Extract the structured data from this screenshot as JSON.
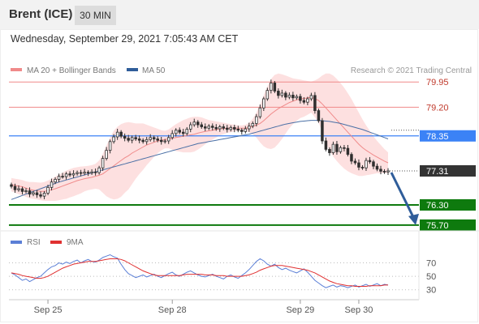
{
  "header": {
    "instrument": "Brent (ICE)",
    "timeframe": "30 MIN"
  },
  "timestamp": "Wednesday, September 29, 2021 7:05:43 AM CET",
  "colors": {
    "candle_up": "#2f2f2f",
    "candle_down": "#2f2f2f",
    "ma20": "#f08a8a",
    "bollinger_fill": "#fcd6d6",
    "ma50": "#4a6fa5",
    "resistance": "#f08a8a",
    "pivot": "#3b82f6",
    "support": "#0e7a0e",
    "last_price": "#333333",
    "rsi": "#5b7fd6",
    "rsi_ma": "#e03030",
    "arrow": "#2f5d9a"
  },
  "chart_data": [
    {
      "type": "candlestick",
      "panel": "price",
      "legend": [
        {
          "name": "MA 20 + Bollinger Bands",
          "color": "#f08a8a"
        },
        {
          "name": "MA 50",
          "color": "#2f5d9a"
        }
      ],
      "copyright": "Research © 2021 Trading Central",
      "x_ticks": [
        "Sep 25",
        "Sep 28",
        "Sep 29",
        "Sep 30"
      ],
      "y_range": [
        75.65,
        80.1
      ],
      "levels": [
        {
          "value": 79.95,
          "label": "79.95",
          "kind": "resistance"
        },
        {
          "value": 79.2,
          "label": "79.20",
          "kind": "resistance"
        },
        {
          "value": 78.35,
          "label": "78.35",
          "kind": "pivot"
        },
        {
          "value": 77.31,
          "label": "77.31",
          "kind": "last"
        },
        {
          "value": 76.3,
          "label": "76.30",
          "kind": "support"
        },
        {
          "value": 75.7,
          "label": "75.70",
          "kind": "support"
        }
      ],
      "close": [
        76.85,
        76.75,
        76.78,
        76.7,
        76.72,
        76.62,
        76.66,
        76.6,
        76.56,
        76.65,
        76.82,
        76.98,
        77.06,
        77.15,
        77.14,
        77.22,
        77.19,
        77.23,
        77.26,
        77.24,
        77.27,
        77.25,
        77.28,
        77.26,
        77.4,
        77.68,
        77.92,
        78.18,
        78.32,
        78.46,
        78.34,
        78.28,
        78.22,
        78.3,
        78.26,
        78.22,
        78.18,
        78.24,
        78.3,
        78.26,
        78.22,
        78.18,
        78.2,
        78.3,
        78.42,
        78.52,
        78.46,
        78.42,
        78.55,
        78.68,
        78.76,
        78.68,
        78.62,
        78.58,
        78.64,
        78.6,
        78.56,
        78.62,
        78.58,
        78.54,
        78.6,
        78.55,
        78.52,
        78.48,
        78.56,
        78.64,
        78.72,
        78.92,
        79.18,
        79.45,
        79.7,
        79.92,
        79.68,
        79.55,
        79.62,
        79.5,
        79.56,
        79.48,
        79.52,
        79.4,
        79.35,
        79.45,
        79.55,
        79.1,
        78.8,
        78.2,
        77.95,
        77.85,
        78.1,
        77.88,
        78.0,
        77.98,
        77.8,
        77.6,
        77.55,
        77.42,
        77.4,
        77.62,
        77.58,
        77.45,
        77.36,
        77.3,
        77.28,
        77.31
      ],
      "ma20": [
        76.9,
        76.88,
        76.86,
        76.84,
        76.8,
        76.76,
        76.74,
        76.72,
        76.7,
        76.7,
        76.72,
        76.75,
        76.78,
        76.82,
        76.86,
        76.9,
        76.94,
        76.98,
        77.02,
        77.05,
        77.08,
        77.1,
        77.12,
        77.15,
        77.18,
        77.22,
        77.3,
        77.38,
        77.46,
        77.54,
        77.62,
        77.7,
        77.76,
        77.84,
        77.9,
        77.96,
        78.02,
        78.08,
        78.12,
        78.16,
        78.2,
        78.22,
        78.24,
        78.26,
        78.28,
        78.3,
        78.32,
        78.34,
        78.36,
        78.38,
        78.4,
        78.43,
        78.46,
        78.48,
        78.5,
        78.52,
        78.54,
        78.56,
        78.57,
        78.58,
        78.58,
        78.58,
        78.58,
        78.58,
        78.58,
        78.6,
        78.63,
        78.67,
        78.72,
        78.8,
        78.9,
        79.0,
        79.08,
        79.16,
        79.22,
        79.28,
        79.34,
        79.38,
        79.42,
        79.45,
        79.46,
        79.48,
        79.5,
        79.45,
        79.4,
        79.3,
        79.18,
        79.06,
        78.94,
        78.82,
        78.7,
        78.58,
        78.46,
        78.34,
        78.22,
        78.1,
        78.0,
        77.92,
        77.85,
        77.78,
        77.72,
        77.66,
        77.6,
        77.55
      ],
      "bb_upper": [
        77.1,
        77.08,
        77.06,
        77.04,
        77.0,
        76.98,
        76.98,
        76.97,
        76.96,
        76.98,
        77.02,
        77.08,
        77.14,
        77.2,
        77.26,
        77.32,
        77.36,
        77.4,
        77.42,
        77.44,
        77.45,
        77.46,
        77.48,
        77.52,
        77.62,
        77.82,
        78.06,
        78.3,
        78.5,
        78.62,
        78.7,
        78.74,
        78.76,
        78.74,
        78.72,
        78.72,
        78.72,
        78.68,
        78.64,
        78.6,
        78.56,
        78.52,
        78.5,
        78.54,
        78.62,
        78.7,
        78.76,
        78.82,
        78.86,
        78.9,
        78.92,
        78.92,
        78.9,
        78.86,
        78.82,
        78.8,
        78.78,
        78.76,
        78.74,
        78.72,
        78.7,
        78.68,
        78.66,
        78.66,
        78.68,
        78.74,
        78.86,
        79.04,
        79.28,
        79.56,
        79.82,
        80.04,
        80.16,
        80.2,
        80.18,
        80.14,
        80.1,
        80.06,
        80.04,
        80.02,
        80.0,
        79.98,
        79.96,
        80.0,
        80.06,
        80.14,
        80.2,
        80.2,
        80.14,
        80.04,
        79.92,
        79.78,
        79.62,
        79.44,
        79.24,
        79.04,
        78.84,
        78.66,
        78.5,
        78.34,
        78.2,
        78.08,
        77.96,
        77.86
      ],
      "bb_lower": [
        76.7,
        76.66,
        76.62,
        76.58,
        76.54,
        76.5,
        76.48,
        76.46,
        76.44,
        76.42,
        76.42,
        76.42,
        76.42,
        76.44,
        76.46,
        76.48,
        76.52,
        76.56,
        76.6,
        76.64,
        76.7,
        76.74,
        76.76,
        76.78,
        76.76,
        76.66,
        76.56,
        76.5,
        76.46,
        76.48,
        76.54,
        76.66,
        76.76,
        76.92,
        77.08,
        77.22,
        77.34,
        77.48,
        77.6,
        77.72,
        77.84,
        77.92,
        77.98,
        77.98,
        77.94,
        77.9,
        77.88,
        77.86,
        77.86,
        77.86,
        77.88,
        77.94,
        78.02,
        78.1,
        78.18,
        78.24,
        78.3,
        78.36,
        78.4,
        78.44,
        78.46,
        78.48,
        78.5,
        78.5,
        78.48,
        78.46,
        78.4,
        78.3,
        78.16,
        78.04,
        77.98,
        77.96,
        78.0,
        78.12,
        78.26,
        78.42,
        78.58,
        78.7,
        78.8,
        78.88,
        78.92,
        78.98,
        79.04,
        78.9,
        78.74,
        78.46,
        78.16,
        77.92,
        77.74,
        77.6,
        77.48,
        77.38,
        77.3,
        77.24,
        77.2,
        77.16,
        77.16,
        77.18,
        77.2,
        77.22,
        77.24,
        77.24,
        77.24,
        77.24
      ],
      "ma50": [
        76.46,
        76.5,
        76.54,
        76.58,
        76.62,
        76.66,
        76.7,
        76.74,
        76.78,
        76.82,
        76.86,
        76.9,
        76.94,
        76.98,
        77.01,
        77.04,
        77.07,
        77.1,
        77.13,
        77.16,
        77.19,
        77.22,
        77.25,
        77.28,
        77.31,
        77.34,
        77.37,
        77.4,
        77.43,
        77.46,
        77.49,
        77.52,
        77.55,
        77.58,
        77.61,
        77.64,
        77.67,
        77.7,
        77.73,
        77.76,
        77.79,
        77.82,
        77.85,
        77.88,
        77.91,
        77.94,
        77.97,
        78.0,
        78.03,
        78.06,
        78.09,
        78.12,
        78.14,
        78.16,
        78.18,
        78.2,
        78.22,
        78.24,
        78.26,
        78.28,
        78.3,
        78.32,
        78.34,
        78.36,
        78.38,
        78.4,
        78.43,
        78.46,
        78.49,
        78.52,
        78.55,
        78.58,
        78.61,
        78.64,
        78.67,
        78.7,
        78.72,
        78.74,
        78.76,
        78.78,
        78.79,
        78.8,
        78.81,
        78.81,
        78.81,
        78.8,
        78.79,
        78.78,
        78.76,
        78.74,
        78.72,
        78.69,
        78.66,
        78.63,
        78.6,
        78.57,
        78.54,
        78.5,
        78.46,
        78.42,
        78.38,
        78.34,
        78.3,
        78.26
      ],
      "forecast": {
        "from": 77.31,
        "to": 75.7
      }
    },
    {
      "type": "line",
      "panel": "rsi",
      "legend": [
        {
          "name": "RSI",
          "color": "#5b7fd6"
        },
        {
          "name": "9MA",
          "color": "#e03030"
        }
      ],
      "y_ticks": [
        70,
        50,
        30
      ],
      "y_range": [
        20,
        85
      ],
      "x_ticks": [
        "Sep 25",
        "Sep 28",
        "Sep 29",
        "Sep 30"
      ],
      "series": [
        {
          "name": "RSI",
          "values": [
            55,
            52,
            48,
            44,
            46,
            42,
            45,
            48,
            50,
            55,
            60,
            64,
            66,
            70,
            68,
            71,
            69,
            72,
            74,
            70,
            73,
            75,
            72,
            71,
            74,
            78,
            80,
            82,
            79,
            77,
            68,
            60,
            54,
            51,
            48,
            50,
            52,
            49,
            51,
            53,
            50,
            48,
            51,
            54,
            56,
            52,
            50,
            53,
            56,
            58,
            55,
            52,
            50,
            49,
            51,
            53,
            50,
            48,
            46,
            50,
            52,
            49,
            47,
            51,
            55,
            60,
            66,
            72,
            76,
            73,
            68,
            65,
            68,
            63,
            60,
            62,
            59,
            57,
            55,
            58,
            61,
            56,
            50,
            44,
            40,
            36,
            33,
            35,
            37,
            34,
            36,
            35,
            33,
            35,
            37,
            34,
            36,
            38,
            35,
            37,
            39,
            36,
            38,
            37
          ]
        },
        {
          "name": "9MA",
          "values": [
            55,
            54,
            53,
            51,
            50,
            49,
            48,
            47,
            47,
            48,
            50,
            53,
            56,
            59,
            62,
            64,
            66,
            68,
            69,
            70,
            71,
            72,
            72,
            72,
            73,
            74,
            75,
            76,
            76,
            76,
            75,
            73,
            70,
            67,
            64,
            61,
            58,
            56,
            54,
            52,
            51,
            51,
            51,
            51,
            51,
            51,
            51,
            52,
            53,
            53,
            53,
            53,
            53,
            52,
            52,
            52,
            51,
            51,
            51,
            50,
            50,
            50,
            50,
            50,
            51,
            52,
            54,
            56,
            59,
            61,
            63,
            65,
            66,
            66,
            66,
            65,
            64,
            63,
            62,
            61,
            60,
            59,
            57,
            55,
            52,
            49,
            46,
            43,
            41,
            39,
            38,
            37,
            36,
            36,
            35,
            35,
            35,
            35,
            36,
            36,
            36,
            36,
            37,
            37
          ]
        }
      ]
    }
  ]
}
